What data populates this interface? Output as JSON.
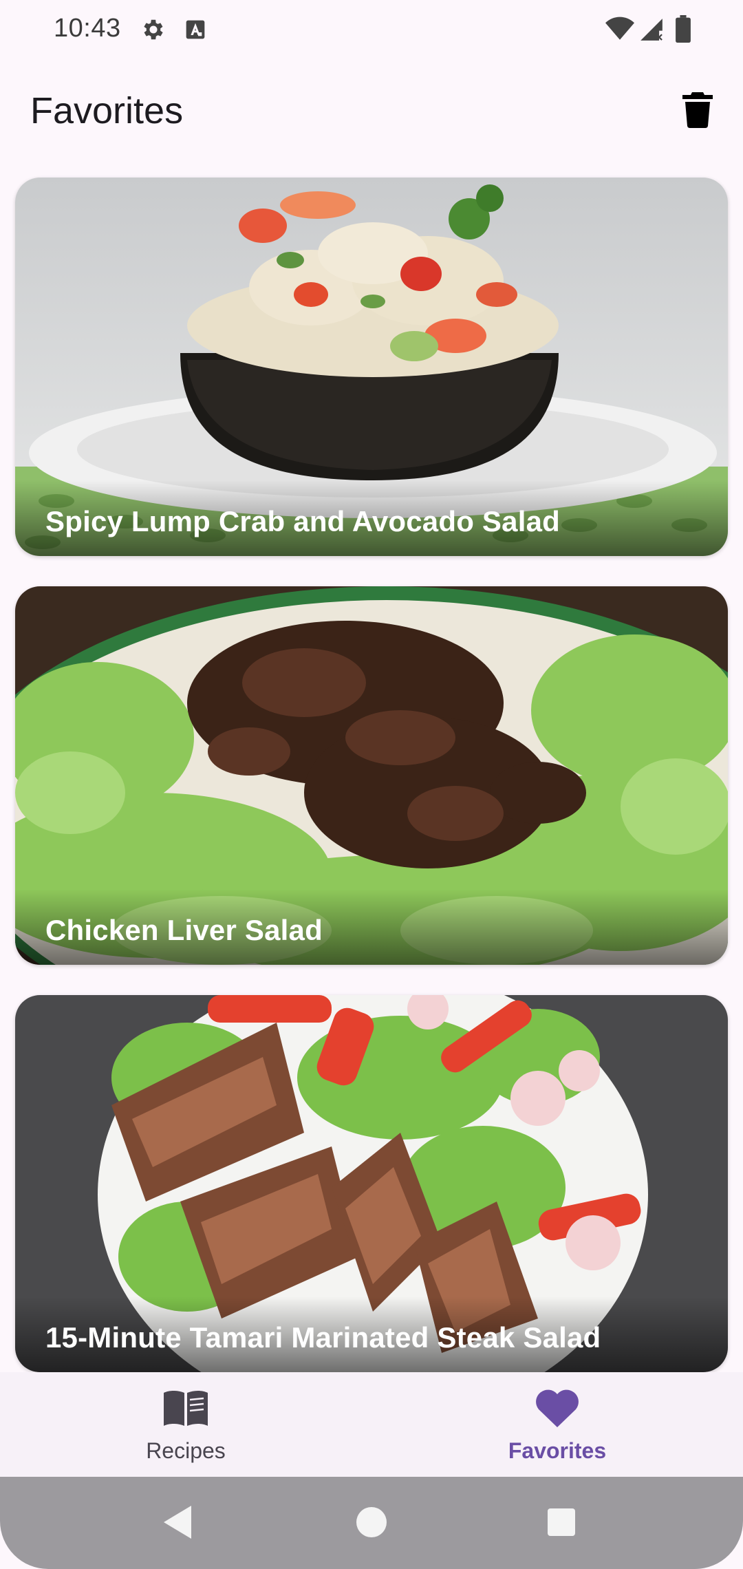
{
  "status_bar": {
    "time": "10:43",
    "icons": [
      "gear-icon",
      "a-badge-icon",
      "wifi-icon",
      "signal-icon",
      "battery-icon"
    ]
  },
  "app_bar": {
    "title": "Favorites",
    "action_icon": "trash-icon"
  },
  "favorites": [
    {
      "title": "Spicy Lump Crab and Avocado Salad"
    },
    {
      "title": "Chicken Liver Salad"
    },
    {
      "title": "15-Minute Tamari Marinated Steak Salad"
    }
  ],
  "bottom_nav": {
    "items": [
      {
        "label": "Recipes",
        "icon": "book-icon",
        "selected": false
      },
      {
        "label": "Favorites",
        "icon": "heart-icon",
        "selected": true
      }
    ]
  },
  "system_nav": {
    "buttons": [
      "back-icon",
      "home-icon",
      "recents-icon"
    ]
  },
  "colors": {
    "accent": "#6a4ea5",
    "background": "#fdf7fc",
    "nav_background": "#f7f1f8"
  }
}
